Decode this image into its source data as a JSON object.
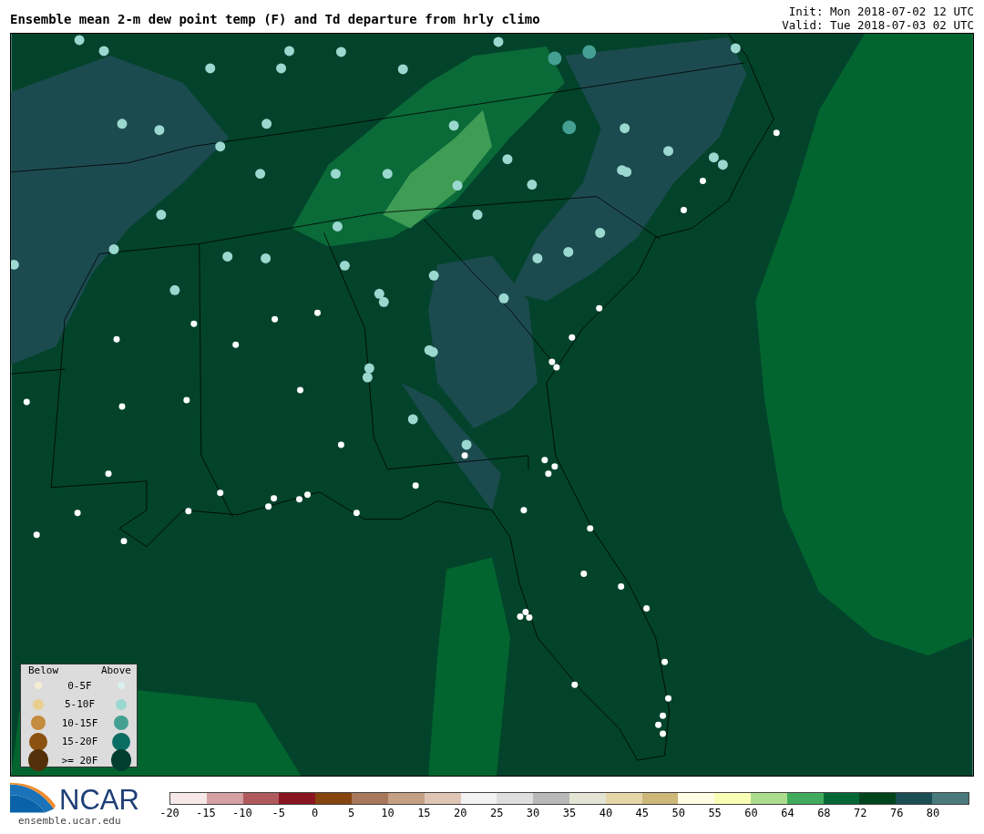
{
  "title": "Ensemble mean 2-m dew point temp (F) and Td departure from hrly climo",
  "init": "Init: Mon 2018-07-02 12 UTC",
  "valid": "Valid: Tue 2018-07-03 02 UTC",
  "legend": {
    "below_label": "Below",
    "above_label": "Above",
    "rows": [
      {
        "label": "0-5F",
        "below": {
          "color": "#f6ecd2"
        },
        "above": {
          "color": "#d9f0ee"
        }
      },
      {
        "label": "5-10F",
        "below": {
          "color": "#e8cf8f"
        },
        "above": {
          "color": "#9bd8d0"
        }
      },
      {
        "label": "10-15F",
        "below": {
          "color": "#c48c3e"
        },
        "above": {
          "color": "#45a093"
        }
      },
      {
        "label": "15-20F",
        "below": {
          "color": "#8b5111"
        },
        "above": {
          "color": "#0a6d63"
        }
      },
      {
        "label": ">= 20F",
        "below": {
          "color": "#53300a"
        },
        "above": {
          "color": "#013d30"
        }
      }
    ]
  },
  "logo": {
    "text": "NCAR",
    "url": "ensemble.ucar.edu"
  },
  "colorbar": {
    "segments": [
      {
        "color": "#f6e8e8"
      },
      {
        "color": "#d4a0a2"
      },
      {
        "color": "#b05a5e"
      },
      {
        "color": "#8a1520"
      },
      {
        "color": "#86440e"
      },
      {
        "color": "#a8785a"
      },
      {
        "color": "#c6a085"
      },
      {
        "color": "#dfc6b4"
      },
      {
        "color": "#f2f2f2"
      },
      {
        "color": "#dedede"
      },
      {
        "color": "#b8b8b8"
      },
      {
        "color": "#e4e4d4"
      },
      {
        "color": "#e6d6aa"
      },
      {
        "color": "#cdb87a"
      },
      {
        "color": "#fffde4"
      },
      {
        "color": "#f8ffb4"
      },
      {
        "color": "#acdd8e"
      },
      {
        "color": "#41ab5d"
      },
      {
        "color": "#006837"
      },
      {
        "color": "#00441b"
      },
      {
        "color": "#1b4e54"
      },
      {
        "color": "#4a7a7c"
      }
    ],
    "ticks": [
      "-20",
      "-15",
      "-10",
      "-5",
      "0",
      "5",
      "10",
      "15",
      "20",
      "25",
      "30",
      "35",
      "40",
      "45",
      "50",
      "55",
      "60",
      "64",
      "68",
      "72",
      "76",
      "80"
    ]
  }
}
